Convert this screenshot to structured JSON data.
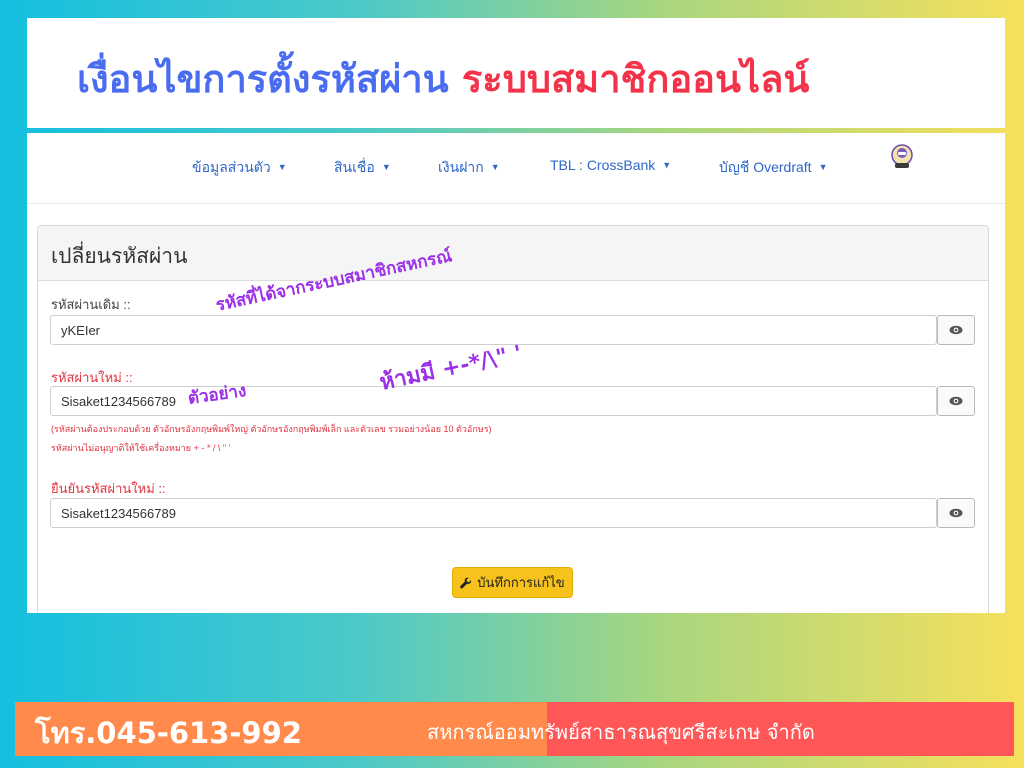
{
  "banner": {
    "title_part1": "เงื่อนไขการตั้งรหัสผ่าน",
    "title_part2": "ระบบสมาชิกออนไลน์"
  },
  "navbar": {
    "items": [
      {
        "label": "ข้อมูลส่วนตัว"
      },
      {
        "label": "สินเชื่อ"
      },
      {
        "label": "เงินฝาก"
      },
      {
        "label": "TBL : CrossBank"
      },
      {
        "label": "บัญชี Overdraft"
      }
    ],
    "caret": "▼",
    "avatar_icon": "user-avatar-icon"
  },
  "panel": {
    "title": "เปลี่ยนรหัสผ่าน",
    "old_password": {
      "label": "รหัสผ่านเดิม ::",
      "value": "yKEIer"
    },
    "new_password": {
      "label": "รหัสผ่านใหม่ ::",
      "value": "Sisaket1234566789"
    },
    "help": [
      "(รหัสผ่านต้องประกอบด้วย ตัวอักษรอังกฤษพิมพ์ใหญ่ ตัวอักษรอังกฤษพิมพ์เล็ก และตัวเลข รวมอย่างน้อย 10 ตัวอักษร)",
      "รหัสผ่านไม่อนุญาติให้ใช้เครื่องหมาย + - * / \\ \" '"
    ],
    "confirm_password": {
      "label": "ยืนยันรหัสผ่านใหม่ ::",
      "value": "Sisaket1234566789"
    },
    "save_label": "บันทึกการแก้ไข",
    "eye_icon": "eye-icon",
    "wrench_icon": "wrench-icon"
  },
  "annotations": {
    "coop_password": "รหัสที่ได้จากระบบสมาชิกสหกรณ์",
    "example": "ตัวอย่าง",
    "forbidden": "ห้ามมี +-*/\\\" '"
  },
  "footer": {
    "phone": "โทร.045-613-992",
    "coop_name": "สหกรณ์ออมทรัพย์สาธารณสุขศรีสะเกษ จำกัด"
  },
  "colors": {
    "title_blue": "#4a6cf0",
    "title_red": "#f2334a",
    "nav_link": "#2f66c7",
    "label_red": "#e0343f",
    "save_button": "#f7c21c",
    "annotation": "#9b30e8",
    "footer_orange": "#ff8a4c",
    "footer_red": "#ff5757"
  }
}
